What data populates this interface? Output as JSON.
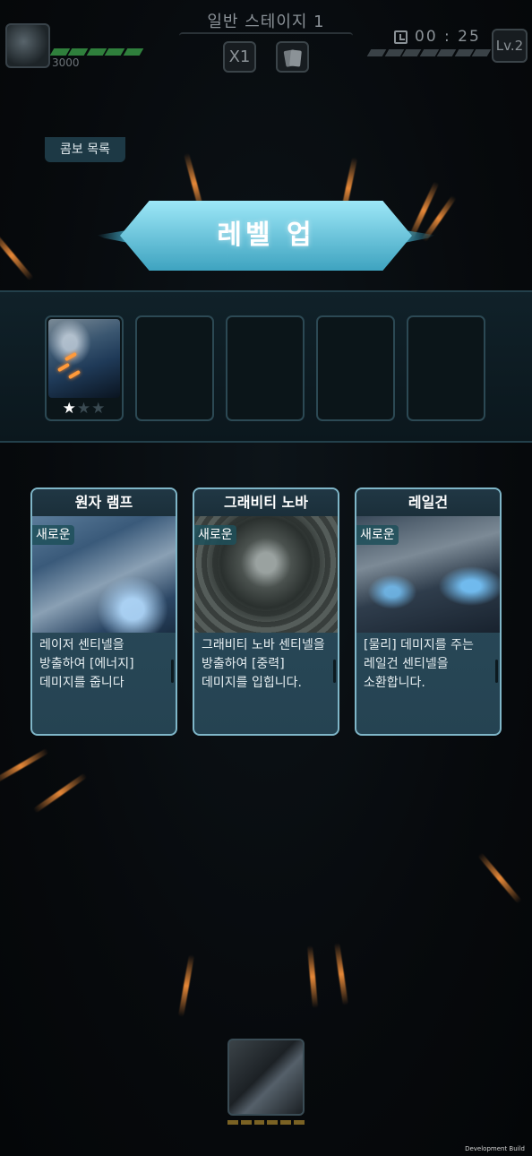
{
  "hud": {
    "stage_title": "일반 스테이지 1",
    "hp_value": "3000",
    "speed_label": "X1",
    "timer": "00 : 25",
    "level": "Lv.2"
  },
  "level_up": {
    "title": "레벨 업"
  },
  "combo": {
    "label": "콤보 목록",
    "slots": [
      {
        "filled": true,
        "stars": 1,
        "max_stars": 3
      },
      {
        "filled": false
      },
      {
        "filled": false
      },
      {
        "filled": false
      },
      {
        "filled": false
      }
    ]
  },
  "choices": [
    {
      "name": "원자 램프",
      "tag": "새로운",
      "description": "레이저 센티넬을 방출하여 [에너지] 데미지를 줍니다"
    },
    {
      "name": "그래비티 노바",
      "tag": "새로운",
      "description": "그래비티 노바 센티넬을 방출하여 [중력] 데미지를 입힙니다."
    },
    {
      "name": "레일건",
      "tag": "새로운",
      "description": "[물리] 데미지를 주는 레일건 센티넬을 소환합니다."
    }
  ],
  "footer": {
    "dev_build": "Development Build"
  },
  "colors": {
    "accent": "#49c6e6",
    "hp_green": "#2f7f3c",
    "streak_orange": "#ff9a3a"
  },
  "icons": [
    "planet-avatar-icon",
    "speed-icon",
    "cards-icon",
    "clock-icon",
    "star-icon"
  ]
}
